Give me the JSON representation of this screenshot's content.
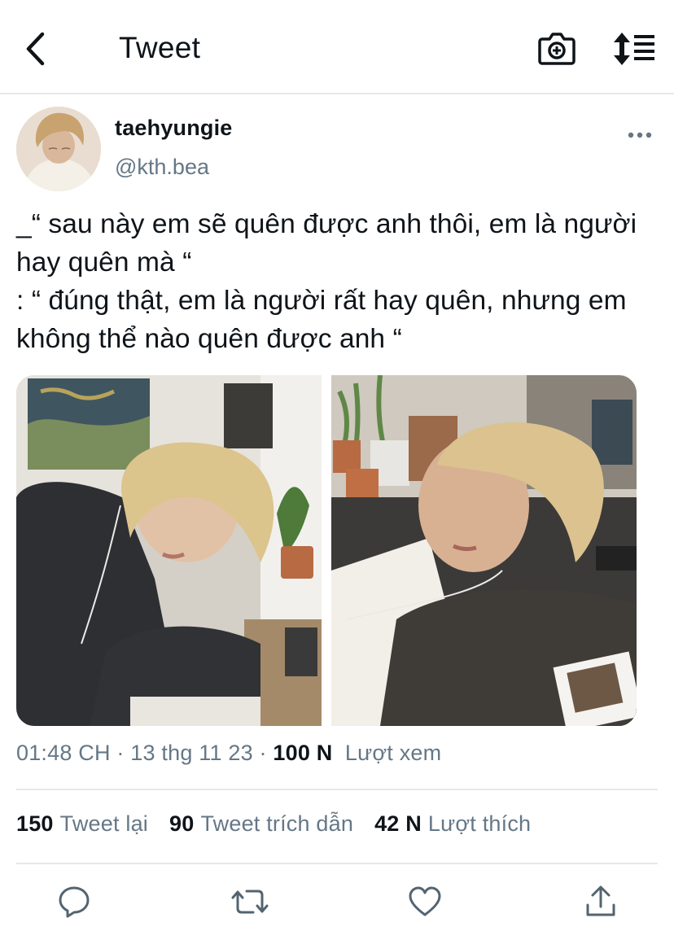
{
  "header": {
    "title": "Tweet"
  },
  "author": {
    "display_name": "taehyungie",
    "handle": "@kth.bea"
  },
  "tweet": {
    "text": "_“ sau này em sẽ quên được anh thôi, em là người hay quên mà “\n: “ đúng thật, em là người rất hay quên, nhưng em không thể nào quên được anh “"
  },
  "meta": {
    "time": "01:48 CH",
    "sep1": " · ",
    "date": "13 thg 11 23",
    "sep2": " · ",
    "views_count": "100 N",
    "views_label": "Lượt xem"
  },
  "stats": {
    "retweets_count": "150",
    "retweets_label": "Tweet lại",
    "quotes_count": "90",
    "quotes_label": "Tweet trích dẫn",
    "likes_count": "42 N",
    "likes_label": "Lượt thích"
  },
  "actions": [
    "reply-icon",
    "retweet-icon",
    "like-icon",
    "share-icon"
  ],
  "colors": {
    "text": "#0f1419",
    "secondary": "#657786",
    "divider": "#e6e8ea"
  }
}
